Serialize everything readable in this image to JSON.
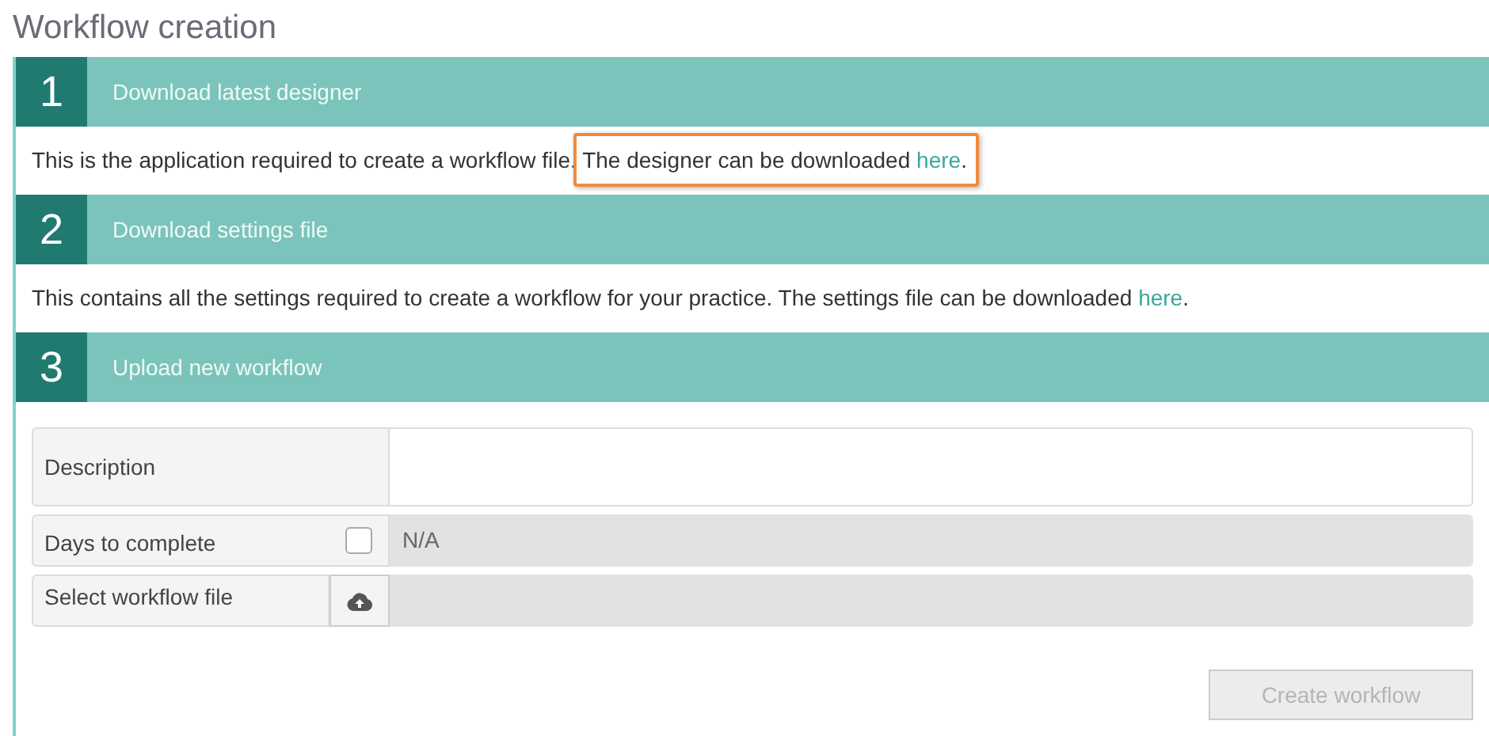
{
  "title": "Workflow creation",
  "steps": [
    {
      "number": "1",
      "title": "Download latest designer",
      "text": "This is the application required to create a workflow file.",
      "link_prefix": "The designer can be downloaded",
      "link": "here",
      "suffix": ".",
      "highlighted": true
    },
    {
      "number": "2",
      "title": "Download settings file",
      "text": "This contains all the settings required to create a workflow for your practice.",
      "link_prefix": "The settings file can be downloaded",
      "link": "here",
      "suffix": ".",
      "highlighted": false
    },
    {
      "number": "3",
      "title": "Upload new workflow"
    }
  ],
  "form": [
    {
      "kind": "textarea",
      "label": "Description"
    },
    {
      "kind": "checkbox",
      "label": "Days to complete",
      "checked": false,
      "value": "N/A"
    },
    {
      "kind": "file",
      "label": "Select workflow file"
    }
  ],
  "submit": {
    "label": "Create workflow",
    "disabled": true
  }
}
